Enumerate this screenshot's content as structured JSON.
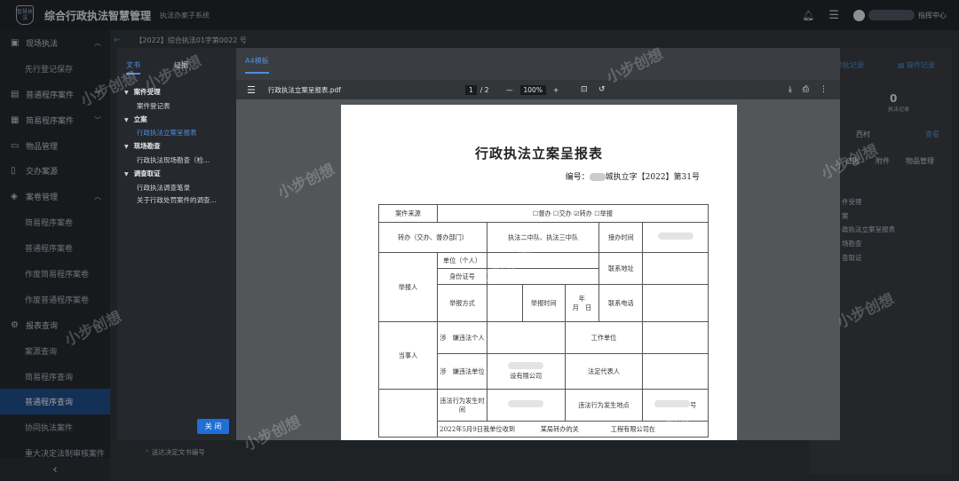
{
  "app": {
    "logo_text": "智慧执法",
    "title": "综合行政执法智慧管理",
    "system_name": "执法办案子系统",
    "user_label": "指挥中心"
  },
  "sidebar": {
    "items": [
      {
        "label": "现场执法",
        "icon": "case-icon",
        "level": "top",
        "arrow": "^"
      },
      {
        "label": "先行登记保存",
        "level": "sub"
      },
      {
        "label": "普通程序案件",
        "icon": "doc-icon",
        "level": "top",
        "arrow": "v"
      },
      {
        "label": "简易程序案件",
        "icon": "building-icon",
        "level": "top",
        "arrow": "v"
      },
      {
        "label": "物品管理",
        "icon": "monitor-icon",
        "level": "top"
      },
      {
        "label": "交办案源",
        "icon": "bookmark-icon",
        "level": "top"
      },
      {
        "label": "案卷管理",
        "icon": "layers-icon",
        "level": "top",
        "arrow": "^"
      },
      {
        "label": "简易程序案卷",
        "level": "sub"
      },
      {
        "label": "普通程序案卷",
        "level": "sub"
      },
      {
        "label": "作废简易程序案卷",
        "level": "sub"
      },
      {
        "label": "作废普通程序案卷",
        "level": "sub"
      },
      {
        "label": "报表查询",
        "icon": "gear-icon",
        "level": "top",
        "arrow": "^"
      },
      {
        "label": "案源查询",
        "level": "sub"
      },
      {
        "label": "简易程序查询",
        "level": "sub"
      },
      {
        "label": "普通程序查询",
        "level": "sub",
        "active": true
      },
      {
        "label": "协同执法案件",
        "level": "sub"
      },
      {
        "label": "重大决定法制审核案件",
        "level": "sub"
      }
    ],
    "collapse_glyph": "‹"
  },
  "background": {
    "breadcrumb": "【2022】综合执法01字第0022 号",
    "approval_record": "审批记录",
    "operation_record": "操作记录",
    "law_records_count": "0",
    "law_records_label": "执法记录",
    "party_suffix": "西村",
    "view_link": "查看",
    "tabs": [
      "证据",
      "附件",
      "物品管理"
    ],
    "progress_items": [
      "件受理",
      "案",
      "政执法立案呈报表",
      "场勘查",
      "查取证"
    ],
    "bottom_field_label": "送达决定文书编号"
  },
  "modal": {
    "tabs": [
      "文书",
      "证据"
    ],
    "tree": [
      {
        "node": "案件受理",
        "leaves": [
          "案件登记表"
        ]
      },
      {
        "node": "立案",
        "leaves": [
          "行政执法立案呈报表"
        ]
      },
      {
        "node": "现场勘查",
        "leaves": [
          "行政执法现场勘查（检..."
        ]
      },
      {
        "node": "调查取证",
        "leaves": [
          "行政执法调查笔录",
          "关于行政处罚案件的调查..."
        ]
      }
    ],
    "selected_leaf": "行政执法立案呈报表",
    "close_button": "关 闭",
    "template_tab": "A4模板"
  },
  "pdf": {
    "file_name": "行政执法立案呈报表.pdf",
    "page_current": "1",
    "page_total": "/ 2",
    "zoom": "100%",
    "minus": "—",
    "plus": "+"
  },
  "document": {
    "title": "行政执法立案呈报表",
    "number_prefix": "编号：",
    "number_suffix": "城执立字【2022】第31号",
    "rows": {
      "source_label": "案件来源",
      "source_options": "☐督办 ☐交办 ☑转办 ☐举报",
      "transfer_label": "转办（交办、督办部门）",
      "transfer_value": "执法二中队、执法三中队",
      "receive_time_label": "接办时间",
      "reporter_label": "举报人",
      "unit_person_label": "单位（个人）",
      "contact_address_label": "联系地址",
      "id_number_label": "身份证号",
      "report_method_label": "举报方式",
      "report_time_label": "举报时间",
      "date_y": "年",
      "date_md": "月　日",
      "contact_phone_label": "联系电话",
      "party_label": "当事人",
      "suspect_person_label": "涉　嫌违法个人",
      "work_unit_label": "工作单位",
      "suspect_unit_label": "涉　嫌违法单位",
      "suspect_unit_value": "设有限公司",
      "legal_rep_label": "法定代表人",
      "violation_time_label": "违法行为发生时间",
      "violation_place_label": "违法行为发生地点",
      "violation_place_value": "号",
      "body_text": "2022年5月9日我单位收到　　　　某局转办的关　　　　　工程有限公司在"
    }
  },
  "watermark": "小步创想",
  "colors": {
    "accent": "#1f6fd6",
    "link": "#4d8fe0",
    "sidebar_active": "#1f4e8c"
  }
}
